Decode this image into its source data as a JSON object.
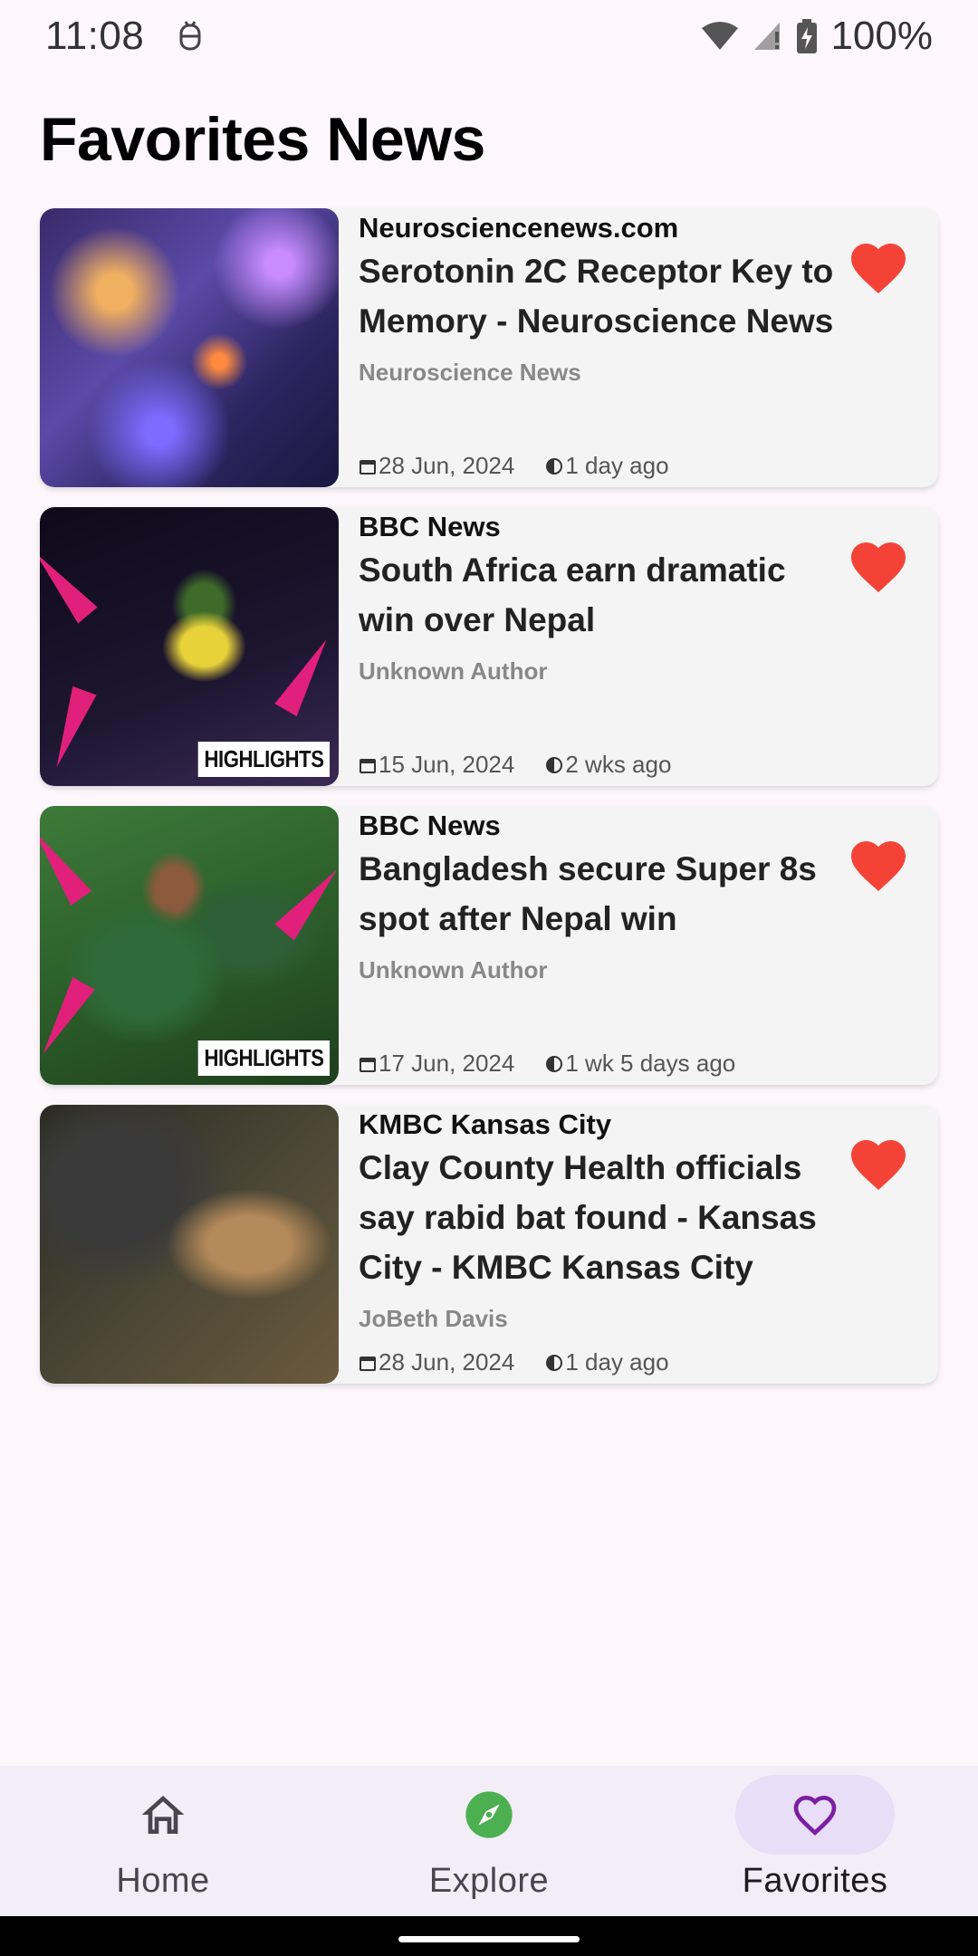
{
  "status_bar": {
    "time": "11:08",
    "battery": "100%",
    "icons": [
      "debug-icon",
      "wifi-icon",
      "signal-icon",
      "battery-icon"
    ]
  },
  "page": {
    "title": "Favorites News"
  },
  "articles": [
    {
      "source": "Neurosciencenews.com",
      "title": "Serotonin 2C Receptor Key to Memory - Neuroscience News",
      "author": "Neuroscience News",
      "date": "28 Jun, 2024",
      "ago": "1 day ago",
      "favorited": true
    },
    {
      "source": "BBC News",
      "title": "South Africa earn dramatic win over Nepal",
      "author": "Unknown Author",
      "date": "15 Jun, 2024",
      "ago": "2 wks ago",
      "favorited": true,
      "badge": "HIGHLIGHTS"
    },
    {
      "source": "BBC News",
      "title": "Bangladesh secure Super 8s spot after Nepal win",
      "author": "Unknown Author",
      "date": "17 Jun, 2024",
      "ago": "1 wk 5 days ago",
      "favorited": true,
      "badge": "HIGHLIGHTS"
    },
    {
      "source": "KMBC Kansas City",
      "title": "Clay County Health officials say rabid bat found - Kansas City - KMBC Kansas City",
      "author": "JoBeth Davis",
      "date": "28 Jun, 2024",
      "ago": "1 day ago",
      "favorited": true
    }
  ],
  "bottom_nav": {
    "items": [
      {
        "label": "Home",
        "icon": "home-icon",
        "active": false
      },
      {
        "label": "Explore",
        "icon": "compass-icon",
        "active": false
      },
      {
        "label": "Favorites",
        "icon": "heart-outline-icon",
        "active": true
      }
    ]
  },
  "colors": {
    "heart": "#f44336",
    "accent": "#7b1fa2",
    "explore_green": "#4caf50",
    "nav_active_bg": "#e8def8"
  }
}
